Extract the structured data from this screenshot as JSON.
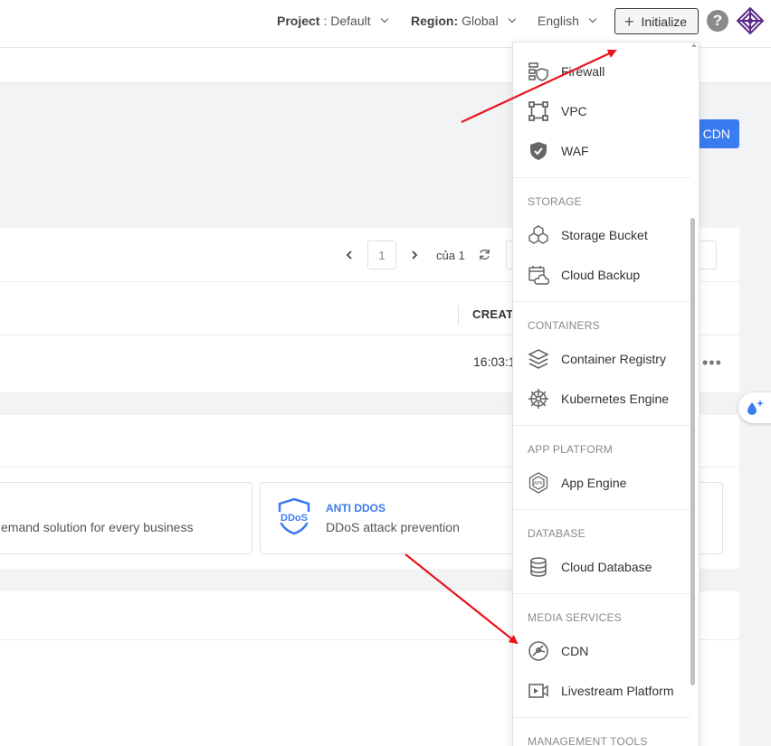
{
  "header": {
    "project_label": "Project",
    "project_value": ": Default",
    "region_label": "Region:",
    "region_value": "Global",
    "language": "English",
    "initialize_label": "Initialize",
    "help_symbol": "?"
  },
  "page": {
    "create_button_partial": "v CDN",
    "pager": {
      "current_page": "1",
      "of_text": "của 1"
    },
    "table": {
      "column_header_partial": "CREATE",
      "row_time_partial": "16:03:1",
      "row_more": "•••"
    },
    "cards": [
      {
        "description_partial": "emand solution for every business"
      },
      {
        "title": "ANTI DDOS",
        "description": "DDoS attack prevention"
      }
    ]
  },
  "dropdown": {
    "items_top": [
      {
        "label": "Firewall",
        "icon": "firewall-icon"
      },
      {
        "label": "VPC",
        "icon": "vpc-icon"
      },
      {
        "label": "WAF",
        "icon": "waf-shield-icon"
      }
    ],
    "sections": [
      {
        "heading": "STORAGE",
        "items": [
          {
            "label": "Storage Bucket",
            "icon": "storage-bucket-icon"
          },
          {
            "label": "Cloud Backup",
            "icon": "cloud-backup-icon"
          }
        ]
      },
      {
        "heading": "CONTAINERS",
        "items": [
          {
            "label": "Container Registry",
            "icon": "container-registry-icon"
          },
          {
            "label": "Kubernetes Engine",
            "icon": "kubernetes-icon"
          }
        ]
      },
      {
        "heading": "APP PLATFORM",
        "items": [
          {
            "label": "App Engine",
            "icon": "app-engine-icon"
          }
        ]
      },
      {
        "heading": "DATABASE",
        "items": [
          {
            "label": "Cloud Database",
            "icon": "database-icon"
          }
        ]
      },
      {
        "heading": "MEDIA SERVICES",
        "items": [
          {
            "label": "CDN",
            "icon": "cdn-icon"
          },
          {
            "label": "Livestream Platform",
            "icon": "livestream-icon"
          }
        ]
      },
      {
        "heading": "MANAGEMENT TOOLS",
        "items": []
      }
    ]
  },
  "colors": {
    "accent": "#3a7bf0",
    "annotation_arrow": "#e8141a",
    "logo": "#5b2a86"
  }
}
